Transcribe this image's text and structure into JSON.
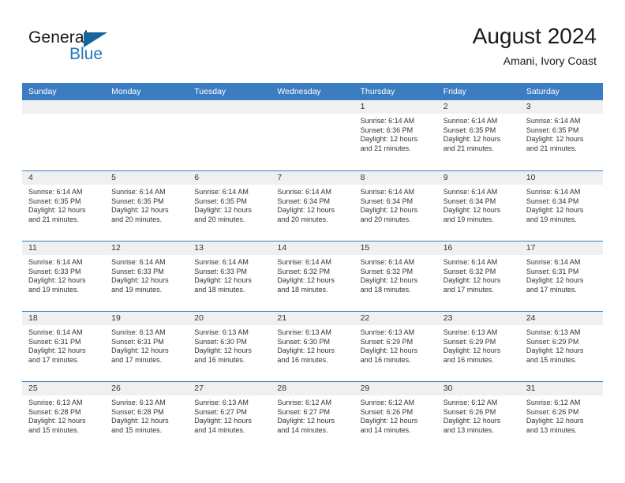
{
  "brand": {
    "word_one": "General",
    "word_two": "Blue",
    "flag_icon": "triangle-flag-icon"
  },
  "header": {
    "title": "August 2024",
    "subtitle": "Amani, Ivory Coast"
  },
  "calendar": {
    "weekday_headers": [
      "Sunday",
      "Monday",
      "Tuesday",
      "Wednesday",
      "Thursday",
      "Friday",
      "Saturday"
    ],
    "accent_color": "#3b7dc0",
    "daynum_band_color": "#f0f0f0",
    "weeks": [
      [
        {
          "day": "",
          "lines": []
        },
        {
          "day": "",
          "lines": []
        },
        {
          "day": "",
          "lines": []
        },
        {
          "day": "",
          "lines": []
        },
        {
          "day": "1",
          "lines": [
            "Sunrise: 6:14 AM",
            "Sunset: 6:36 PM",
            "Daylight: 12 hours",
            "and 21 minutes."
          ]
        },
        {
          "day": "2",
          "lines": [
            "Sunrise: 6:14 AM",
            "Sunset: 6:35 PM",
            "Daylight: 12 hours",
            "and 21 minutes."
          ]
        },
        {
          "day": "3",
          "lines": [
            "Sunrise: 6:14 AM",
            "Sunset: 6:35 PM",
            "Daylight: 12 hours",
            "and 21 minutes."
          ]
        }
      ],
      [
        {
          "day": "4",
          "lines": [
            "Sunrise: 6:14 AM",
            "Sunset: 6:35 PM",
            "Daylight: 12 hours",
            "and 21 minutes."
          ]
        },
        {
          "day": "5",
          "lines": [
            "Sunrise: 6:14 AM",
            "Sunset: 6:35 PM",
            "Daylight: 12 hours",
            "and 20 minutes."
          ]
        },
        {
          "day": "6",
          "lines": [
            "Sunrise: 6:14 AM",
            "Sunset: 6:35 PM",
            "Daylight: 12 hours",
            "and 20 minutes."
          ]
        },
        {
          "day": "7",
          "lines": [
            "Sunrise: 6:14 AM",
            "Sunset: 6:34 PM",
            "Daylight: 12 hours",
            "and 20 minutes."
          ]
        },
        {
          "day": "8",
          "lines": [
            "Sunrise: 6:14 AM",
            "Sunset: 6:34 PM",
            "Daylight: 12 hours",
            "and 20 minutes."
          ]
        },
        {
          "day": "9",
          "lines": [
            "Sunrise: 6:14 AM",
            "Sunset: 6:34 PM",
            "Daylight: 12 hours",
            "and 19 minutes."
          ]
        },
        {
          "day": "10",
          "lines": [
            "Sunrise: 6:14 AM",
            "Sunset: 6:34 PM",
            "Daylight: 12 hours",
            "and 19 minutes."
          ]
        }
      ],
      [
        {
          "day": "11",
          "lines": [
            "Sunrise: 6:14 AM",
            "Sunset: 6:33 PM",
            "Daylight: 12 hours",
            "and 19 minutes."
          ]
        },
        {
          "day": "12",
          "lines": [
            "Sunrise: 6:14 AM",
            "Sunset: 6:33 PM",
            "Daylight: 12 hours",
            "and 19 minutes."
          ]
        },
        {
          "day": "13",
          "lines": [
            "Sunrise: 6:14 AM",
            "Sunset: 6:33 PM",
            "Daylight: 12 hours",
            "and 18 minutes."
          ]
        },
        {
          "day": "14",
          "lines": [
            "Sunrise: 6:14 AM",
            "Sunset: 6:32 PM",
            "Daylight: 12 hours",
            "and 18 minutes."
          ]
        },
        {
          "day": "15",
          "lines": [
            "Sunrise: 6:14 AM",
            "Sunset: 6:32 PM",
            "Daylight: 12 hours",
            "and 18 minutes."
          ]
        },
        {
          "day": "16",
          "lines": [
            "Sunrise: 6:14 AM",
            "Sunset: 6:32 PM",
            "Daylight: 12 hours",
            "and 17 minutes."
          ]
        },
        {
          "day": "17",
          "lines": [
            "Sunrise: 6:14 AM",
            "Sunset: 6:31 PM",
            "Daylight: 12 hours",
            "and 17 minutes."
          ]
        }
      ],
      [
        {
          "day": "18",
          "lines": [
            "Sunrise: 6:14 AM",
            "Sunset: 6:31 PM",
            "Daylight: 12 hours",
            "and 17 minutes."
          ]
        },
        {
          "day": "19",
          "lines": [
            "Sunrise: 6:13 AM",
            "Sunset: 6:31 PM",
            "Daylight: 12 hours",
            "and 17 minutes."
          ]
        },
        {
          "day": "20",
          "lines": [
            "Sunrise: 6:13 AM",
            "Sunset: 6:30 PM",
            "Daylight: 12 hours",
            "and 16 minutes."
          ]
        },
        {
          "day": "21",
          "lines": [
            "Sunrise: 6:13 AM",
            "Sunset: 6:30 PM",
            "Daylight: 12 hours",
            "and 16 minutes."
          ]
        },
        {
          "day": "22",
          "lines": [
            "Sunrise: 6:13 AM",
            "Sunset: 6:29 PM",
            "Daylight: 12 hours",
            "and 16 minutes."
          ]
        },
        {
          "day": "23",
          "lines": [
            "Sunrise: 6:13 AM",
            "Sunset: 6:29 PM",
            "Daylight: 12 hours",
            "and 16 minutes."
          ]
        },
        {
          "day": "24",
          "lines": [
            "Sunrise: 6:13 AM",
            "Sunset: 6:29 PM",
            "Daylight: 12 hours",
            "and 15 minutes."
          ]
        }
      ],
      [
        {
          "day": "25",
          "lines": [
            "Sunrise: 6:13 AM",
            "Sunset: 6:28 PM",
            "Daylight: 12 hours",
            "and 15 minutes."
          ]
        },
        {
          "day": "26",
          "lines": [
            "Sunrise: 6:13 AM",
            "Sunset: 6:28 PM",
            "Daylight: 12 hours",
            "and 15 minutes."
          ]
        },
        {
          "day": "27",
          "lines": [
            "Sunrise: 6:13 AM",
            "Sunset: 6:27 PM",
            "Daylight: 12 hours",
            "and 14 minutes."
          ]
        },
        {
          "day": "28",
          "lines": [
            "Sunrise: 6:12 AM",
            "Sunset: 6:27 PM",
            "Daylight: 12 hours",
            "and 14 minutes."
          ]
        },
        {
          "day": "29",
          "lines": [
            "Sunrise: 6:12 AM",
            "Sunset: 6:26 PM",
            "Daylight: 12 hours",
            "and 14 minutes."
          ]
        },
        {
          "day": "30",
          "lines": [
            "Sunrise: 6:12 AM",
            "Sunset: 6:26 PM",
            "Daylight: 12 hours",
            "and 13 minutes."
          ]
        },
        {
          "day": "31",
          "lines": [
            "Sunrise: 6:12 AM",
            "Sunset: 6:26 PM",
            "Daylight: 12 hours",
            "and 13 minutes."
          ]
        }
      ]
    ]
  }
}
